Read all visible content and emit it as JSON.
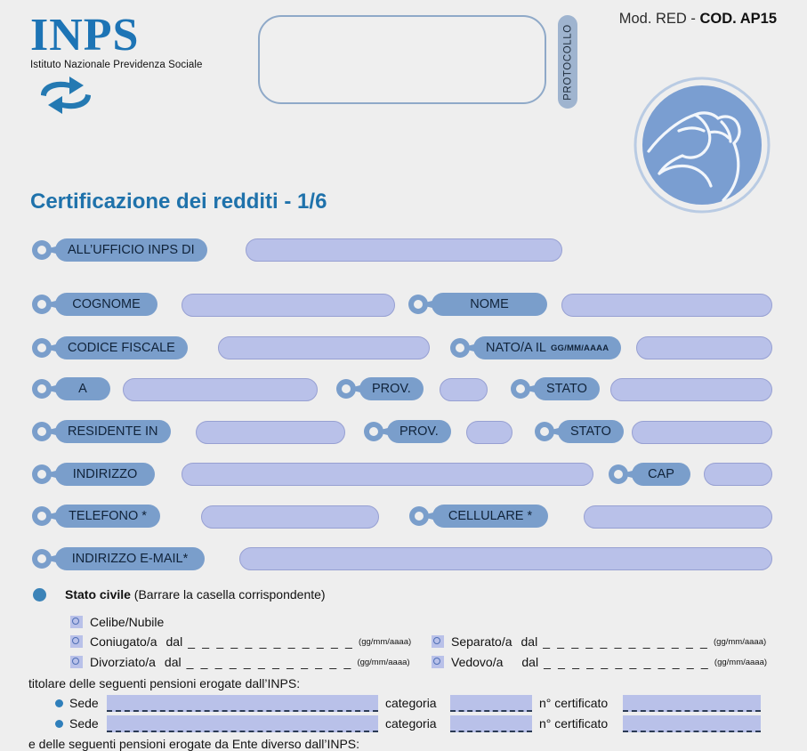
{
  "header": {
    "logo_word": "INPS",
    "logo_subtitle": "Istituto Nazionale Previdenza Sociale",
    "mod_prefix": "Mod. RED - ",
    "mod_code": "COD. AP15",
    "protocollo_label": "PROTOCOLLO"
  },
  "title": "Certificazione dei redditi - 1/6",
  "fields": {
    "ufficio": "ALL’UFFICIO INPS DI",
    "cognome": "COGNOME",
    "nome": "NOME",
    "codice_fiscale": "CODICE FISCALE",
    "nato_il": "NATO/A IL",
    "nato_il_hint": "GG/MM/AAAA",
    "a": "A",
    "prov1": "PROV.",
    "stato1": "STATO",
    "residente": "RESIDENTE IN",
    "prov2": "PROV.",
    "stato2": "STATO",
    "indirizzo": "INDIRIZZO",
    "cap": "CAP",
    "telefono": "TELEFONO *",
    "cellulare": "CELLULARE *",
    "email": "INDIRIZZO E-MAIL*"
  },
  "civil_status": {
    "heading_bold": "Stato civile",
    "heading_rest": " (Barrare la casella corrispondente)",
    "dash_line": "_ _ _ _ _ _ _ _ _ _ _ _",
    "date_format": "(gg/mm/aaaa)",
    "dal": "dal",
    "options_left": [
      {
        "label": "Celibe/Nubile",
        "has_date": false
      },
      {
        "label": "Coniugato/a",
        "has_date": true
      },
      {
        "label": "Divorziato/a",
        "has_date": true
      }
    ],
    "options_right": [
      {
        "label": "Separato/a",
        "has_date": true
      },
      {
        "label": "Vedovo/a",
        "has_date": true
      }
    ]
  },
  "pensions": {
    "intro": "titolare delle seguenti pensioni erogate dall’INPS:",
    "row_label": "Sede",
    "categoria_label": "categoria",
    "certificato_label": "n° certificato",
    "rows": [
      {
        "sede": "",
        "categoria": "",
        "certificato": ""
      },
      {
        "sede": "",
        "categoria": "",
        "certificato": ""
      }
    ],
    "footer": "e delle seguenti pensioni erogate da Ente diverso dall’INPS:"
  },
  "colors": {
    "page_bg": "#eeeeee",
    "title_blue": "#1f72ab",
    "tag_blue": "#7a9ecb",
    "field_fill": "#b9c1e9",
    "field_border": "#97a0d2",
    "emblem_blue": "#7a9ed1",
    "bullet_blue": "#3b83b8"
  }
}
